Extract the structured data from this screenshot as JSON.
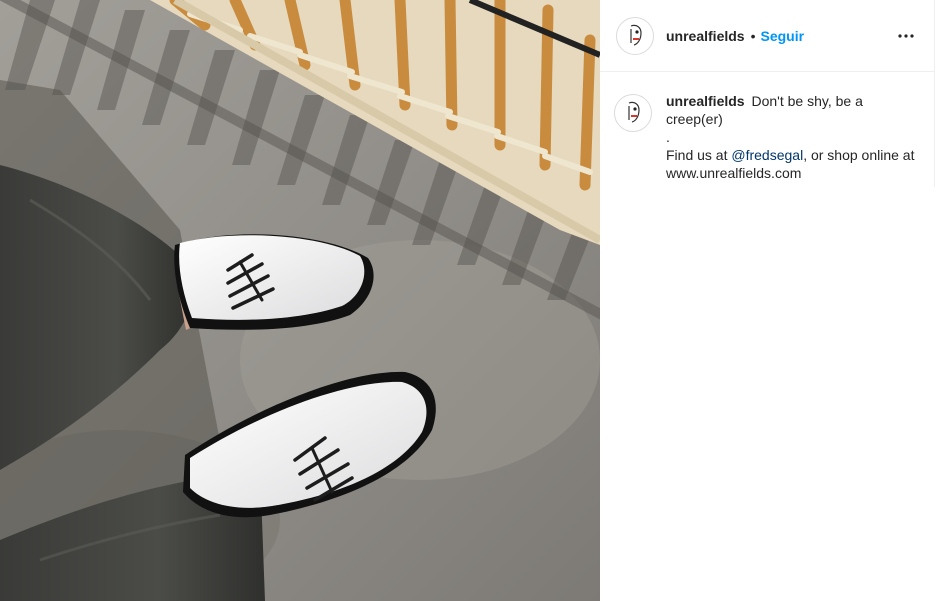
{
  "photo": {
    "alt_icon": "photo-shoes"
  },
  "header": {
    "avatar_icon": "face-sketch-avatar-icon",
    "username": "unrealfields",
    "separator": "•",
    "follow_label": "Seguir",
    "more_icon": "ellipsis-icon"
  },
  "caption": {
    "username": "unrealfields",
    "text_line1": "Don't be shy, be a creep(er)",
    "text_line2": ".",
    "text_line3_prefix": "Find us at ",
    "mention": "@fredsegal",
    "text_line3_suffix": ", or shop online at www.unrealfields.com"
  },
  "colors": {
    "accent": "#0095f6",
    "mention": "#00376b",
    "text": "#262626",
    "border": "#efefef"
  }
}
